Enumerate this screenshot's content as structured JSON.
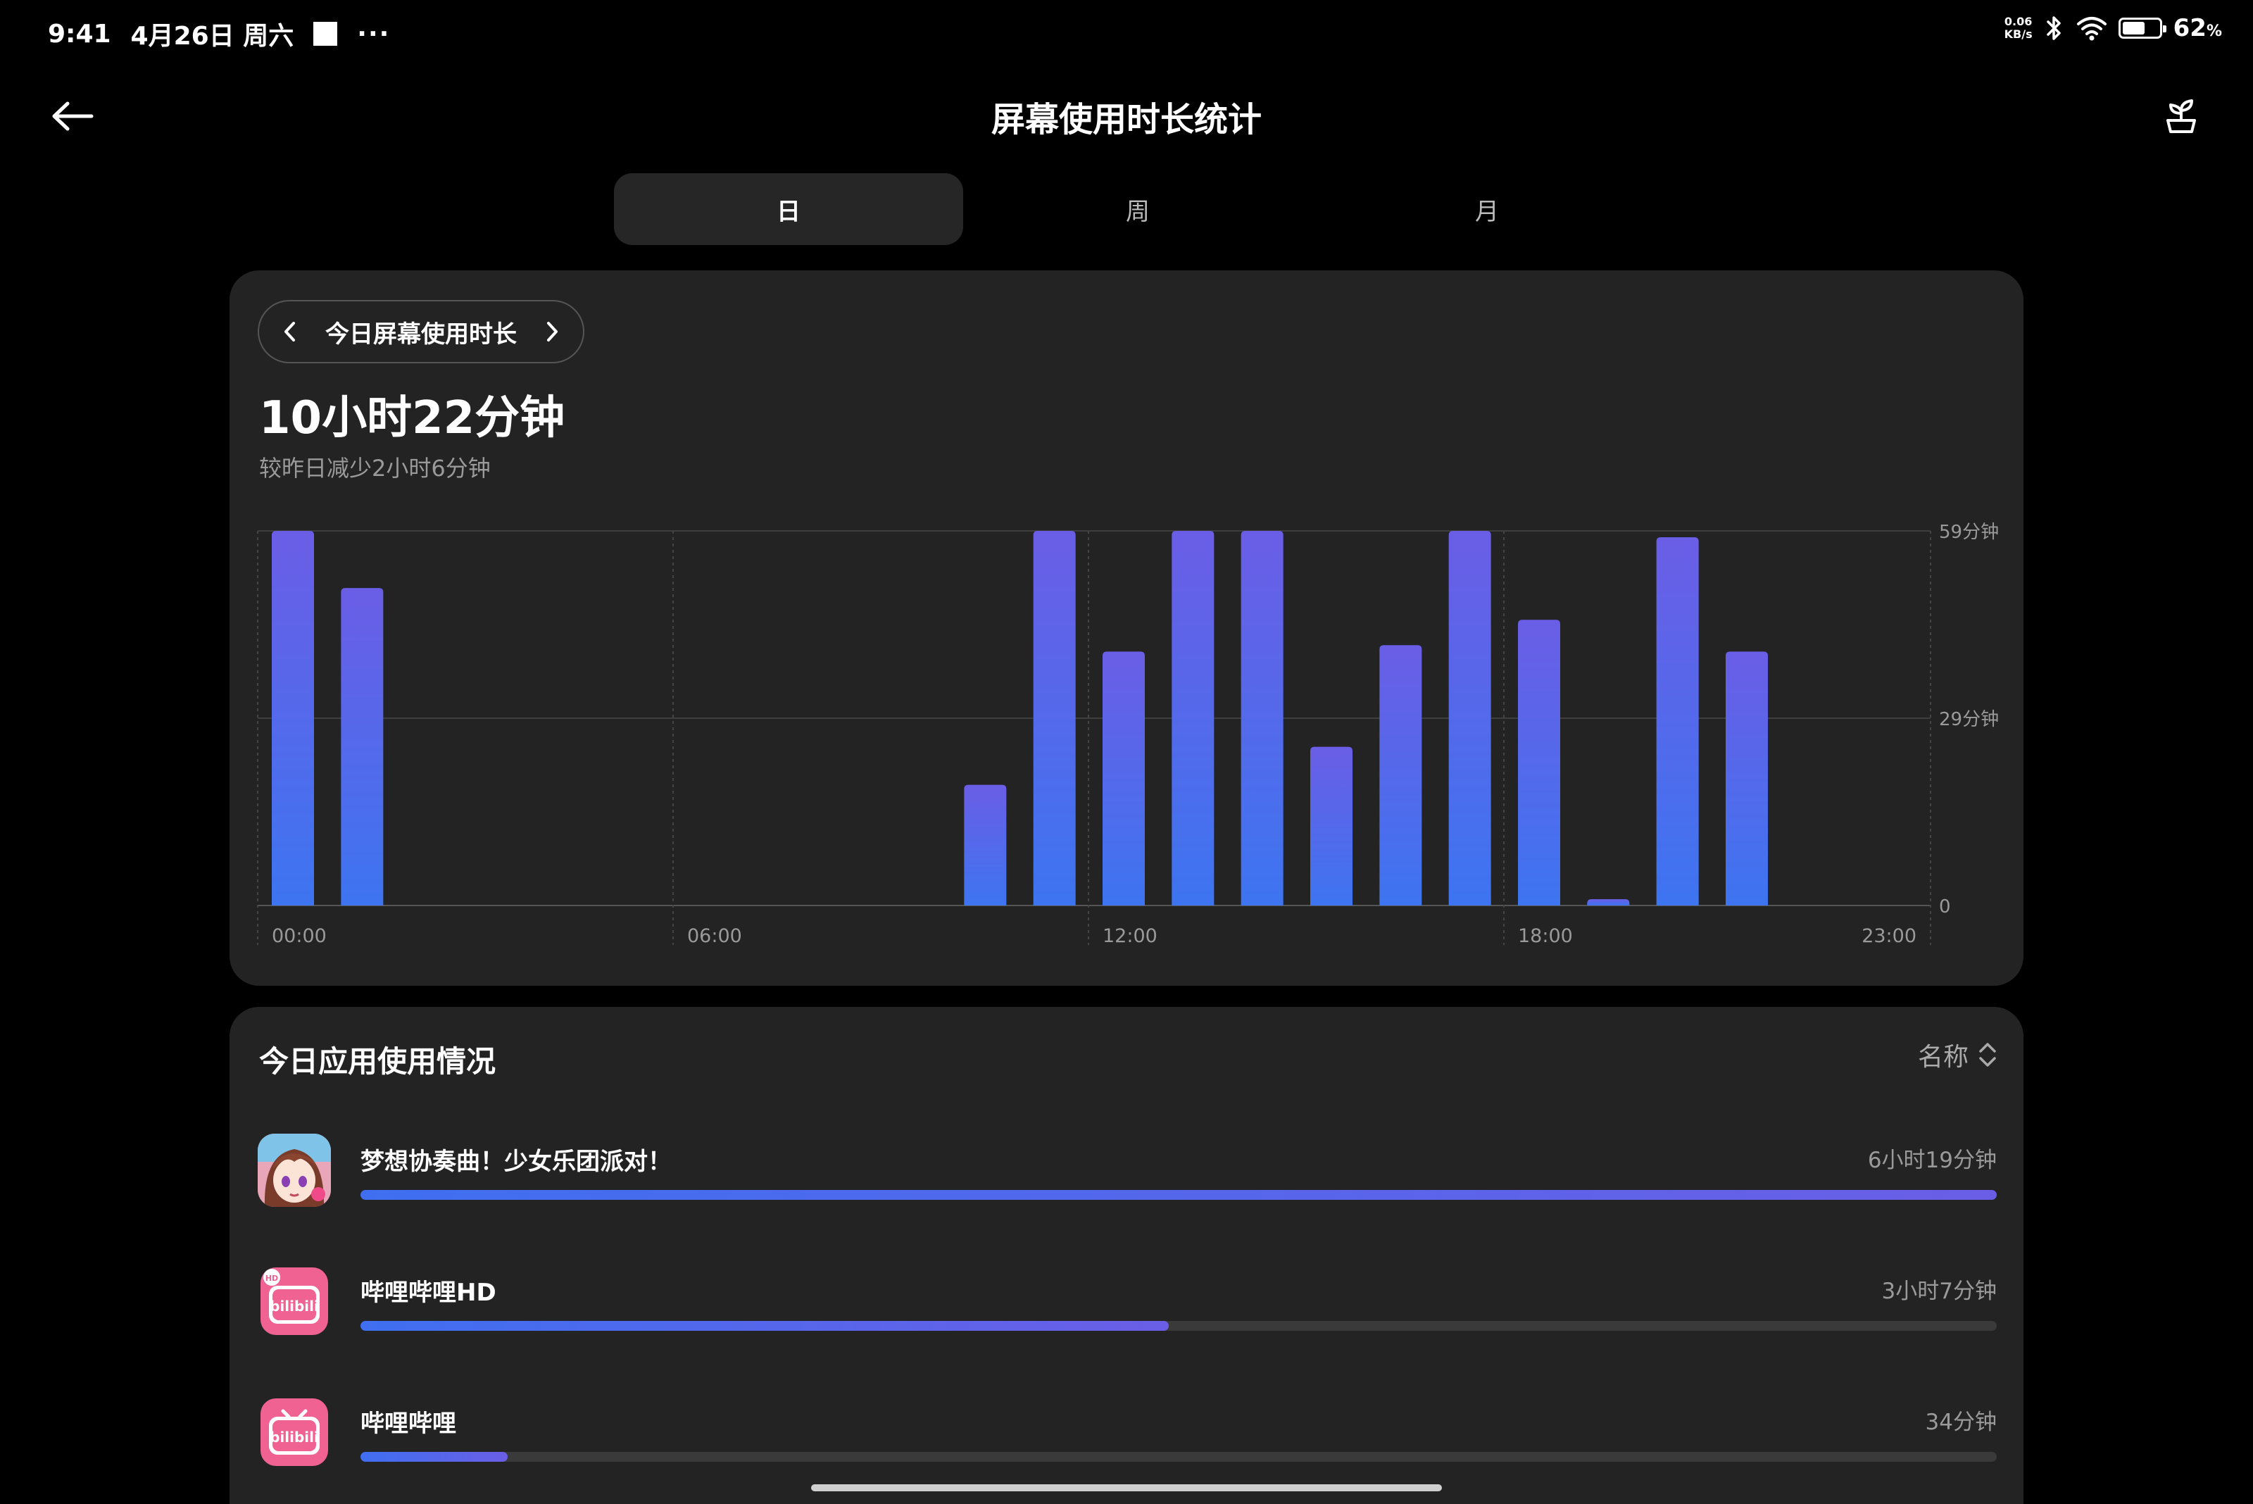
{
  "status_bar": {
    "time": "9:41",
    "date": "4月26日",
    "weekday": "周六",
    "more": "···",
    "net_speed_value": "0.06",
    "net_speed_unit": "KB/s",
    "battery_percent": "62",
    "battery_suffix": "%",
    "battery_level": 0.62
  },
  "header": {
    "title": "屏幕使用时长统计",
    "back_icon": "back-arrow-icon",
    "right_icon": "sprout-icon"
  },
  "tabs": [
    {
      "label": "日",
      "active": true
    },
    {
      "label": "周",
      "active": false
    },
    {
      "label": "月",
      "active": false
    }
  ],
  "summary": {
    "period_label": "今日屏幕使用时长",
    "total": "10小时22分钟",
    "delta": "较昨日减少2小时6分钟"
  },
  "chart_data": {
    "type": "bar",
    "x": [
      "00:00",
      "01:00",
      "02:00",
      "03:00",
      "04:00",
      "05:00",
      "06:00",
      "07:00",
      "08:00",
      "09:00",
      "10:00",
      "11:00",
      "12:00",
      "13:00",
      "14:00",
      "15:00",
      "16:00",
      "17:00",
      "18:00",
      "19:00",
      "20:00",
      "21:00",
      "22:00",
      "23:00"
    ],
    "values": [
      59,
      50,
      0,
      0,
      0,
      0,
      0,
      0,
      0,
      0,
      19,
      59,
      40,
      59,
      59,
      25,
      41,
      59,
      45,
      1,
      58,
      40,
      0,
      0
    ],
    "x_tick_labels": [
      "00:00",
      "06:00",
      "12:00",
      "18:00",
      "23:00"
    ],
    "y_tick_labels": [
      "59分钟",
      "29分钟",
      "0"
    ],
    "ylim": [
      0,
      59
    ],
    "colors": {
      "top": "#6a5ee6",
      "bottom": "#3d74f0"
    },
    "grid": true
  },
  "apps_section": {
    "title": "今日应用使用情况",
    "sort_label": "名称",
    "sort_icon": "sort-updown-icon",
    "apps": [
      {
        "name": "梦想协奏曲！少女乐团派对！",
        "time": "6小时19分钟",
        "fraction": 1.0,
        "icon": "bandori-app-icon"
      },
      {
        "name": "哔哩哔哩HD",
        "time": "3小时7分钟",
        "fraction": 0.494,
        "icon": "bilibili-hd-app-icon"
      },
      {
        "name": "哔哩哔哩",
        "time": "34分钟",
        "fraction": 0.09,
        "icon": "bilibili-app-icon"
      }
    ]
  },
  "bilibili_logo_text": "bilibili",
  "bilibili_hd_badge": "HD"
}
